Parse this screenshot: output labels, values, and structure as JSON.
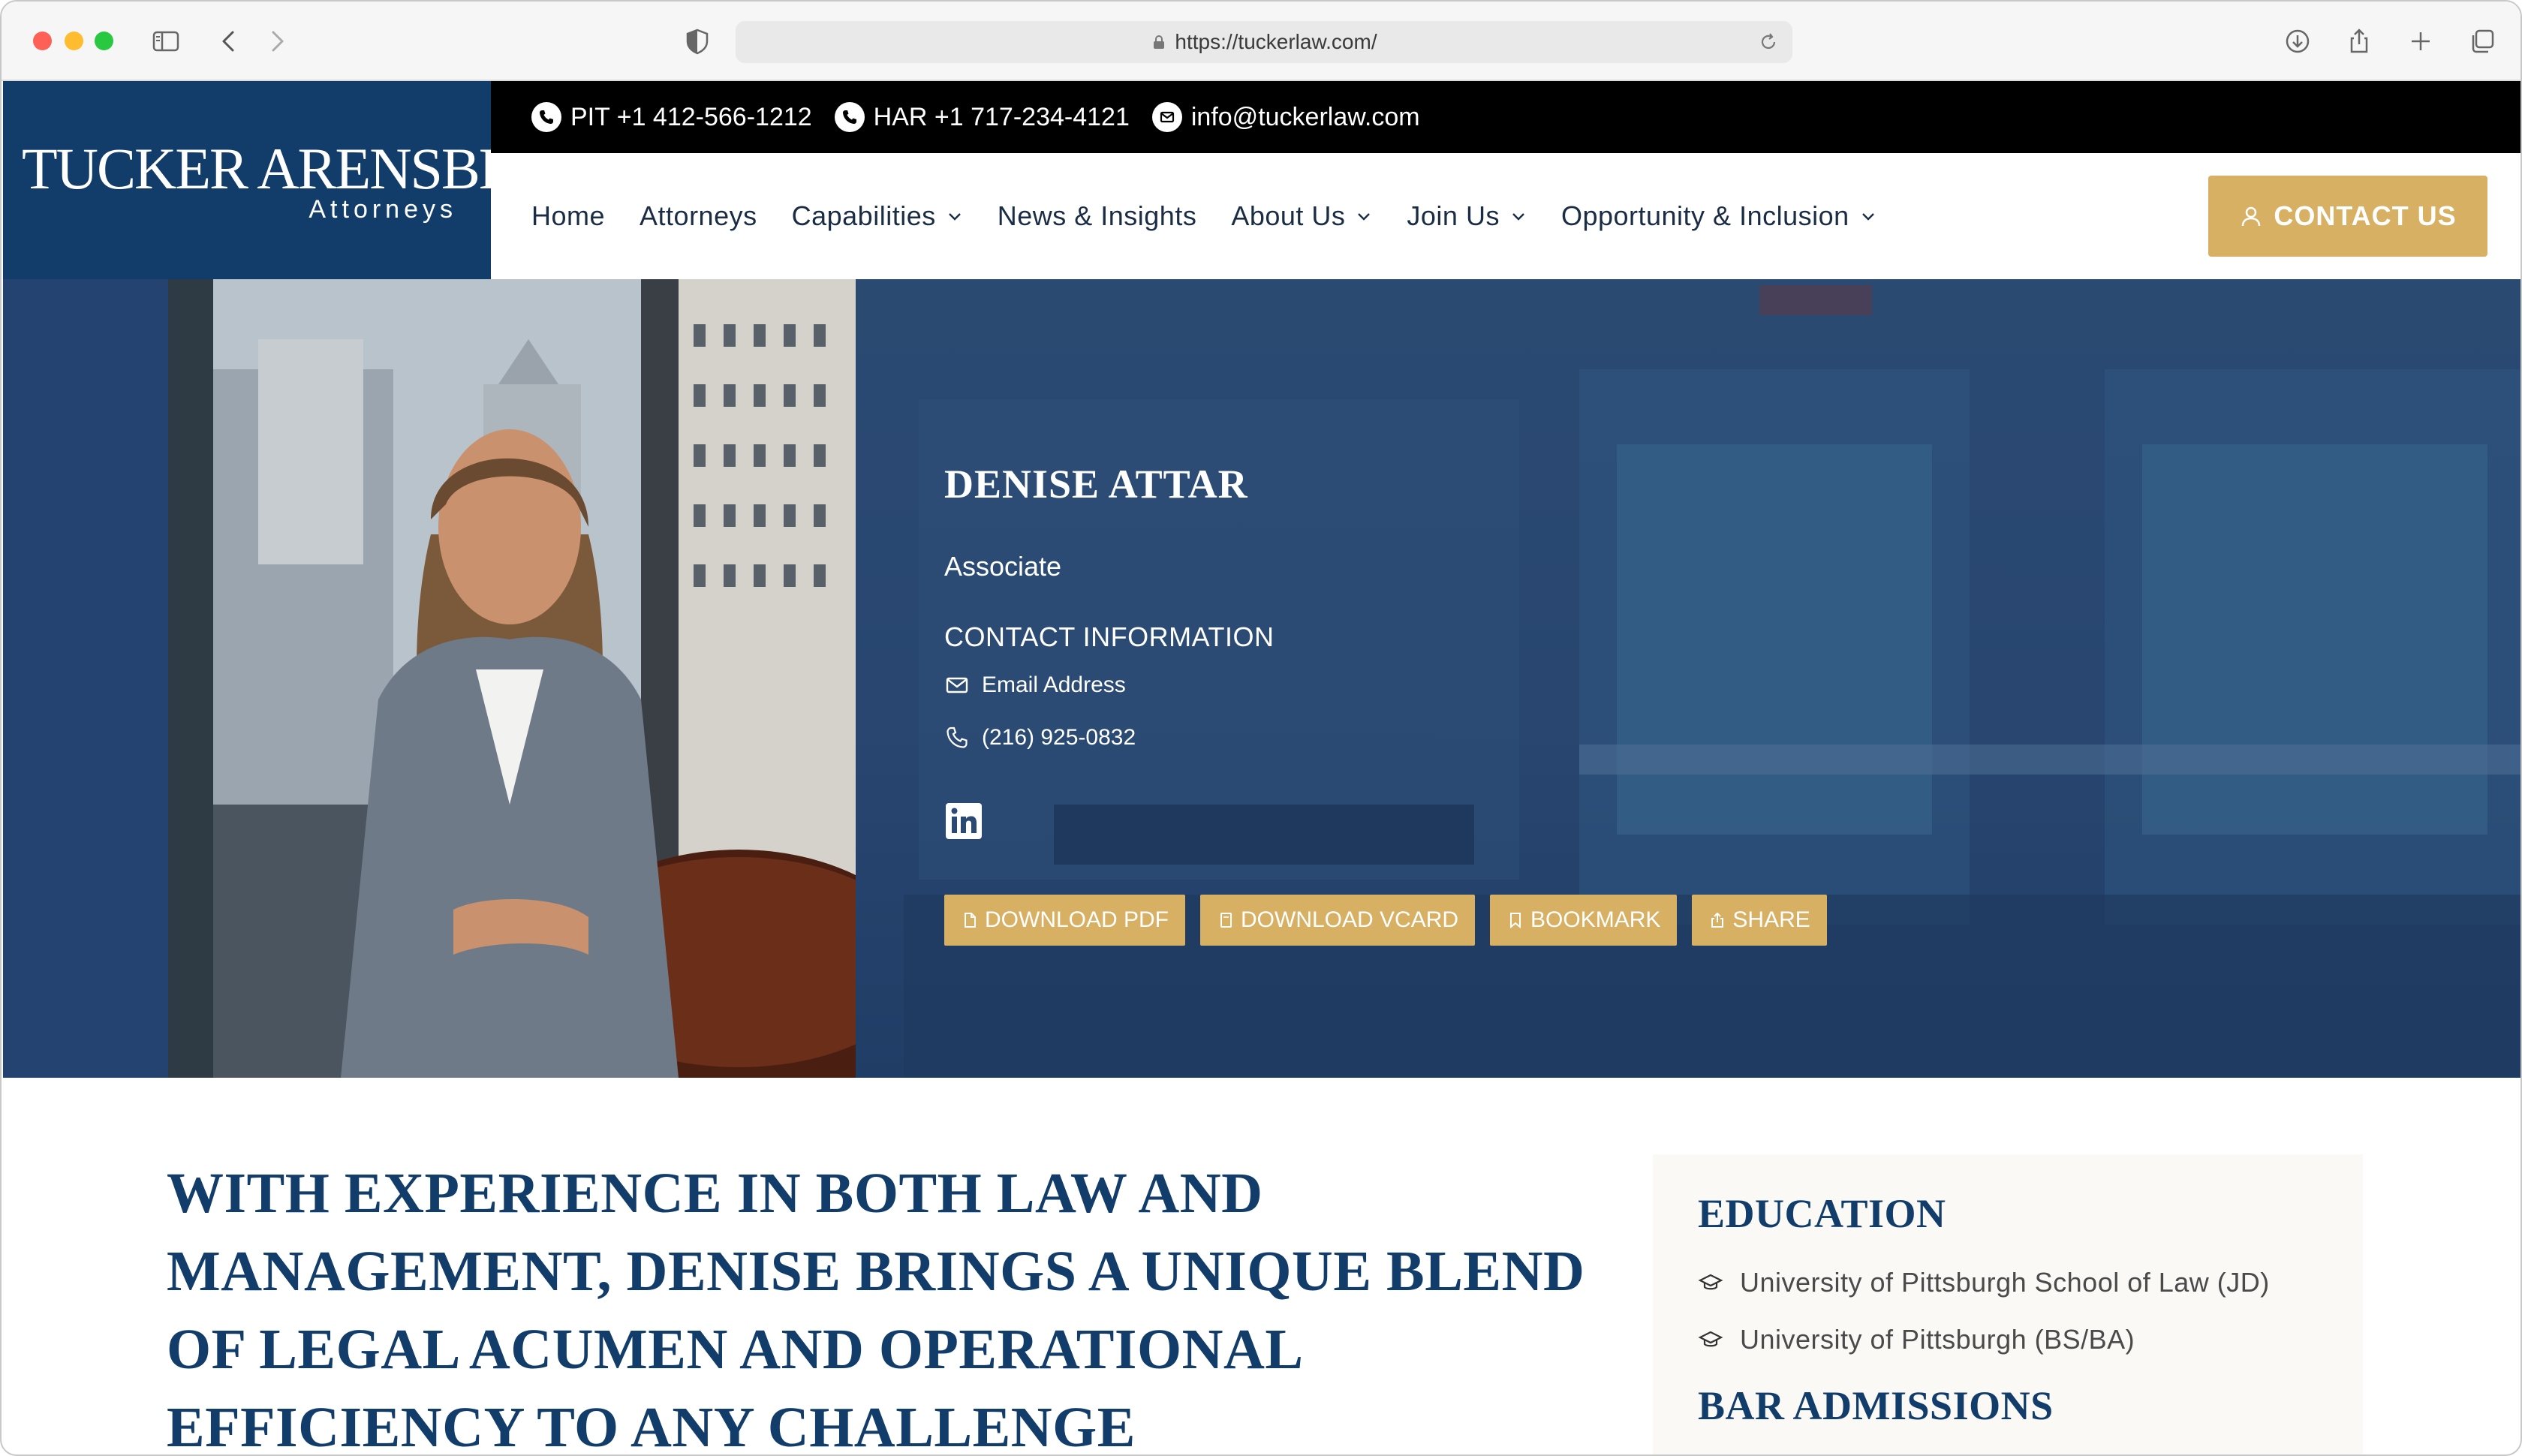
{
  "browser": {
    "url": "https://tuckerlaw.com/"
  },
  "topbar": {
    "pit": "PIT +1 412-566-1212",
    "har": "HAR +1 717-234-4121",
    "email": "info@tuckerlaw.com"
  },
  "logo": {
    "name": "TUCKER ARENSBERG",
    "sub": "Attorneys"
  },
  "nav": {
    "items": [
      {
        "label": "Home",
        "dropdown": false
      },
      {
        "label": "Attorneys",
        "dropdown": false
      },
      {
        "label": "Capabilities",
        "dropdown": true
      },
      {
        "label": "News & Insights",
        "dropdown": false
      },
      {
        "label": "About Us",
        "dropdown": true
      },
      {
        "label": "Join Us",
        "dropdown": true
      },
      {
        "label": "Opportunity & Inclusion",
        "dropdown": true
      }
    ],
    "contact_label": "CONTACT US"
  },
  "profile": {
    "name": "DENISE ATTAR",
    "title": "Associate",
    "contact_heading": "CONTACT INFORMATION",
    "email_label": "Email Address",
    "phone": "(216) 925-0832",
    "buttons": {
      "pdf": "DOWNLOAD PDF",
      "vcard": "DOWNLOAD VCARD",
      "bookmark": "BOOKMARK",
      "share": "SHARE"
    }
  },
  "quote": "WITH EXPERIENCE IN BOTH LAW AND MANAGEMENT, DENISE BRINGS A UNIQUE BLEND OF LEGAL ACUMEN AND OPERATIONAL EFFICIENCY TO ANY CHALLENGE",
  "sidebar": {
    "education_heading": "EDUCATION",
    "education": [
      "University of Pittsburgh School of Law (JD)",
      "University of Pittsburgh (BS/BA)"
    ],
    "bar_heading": "BAR ADMISSIONS"
  },
  "colors": {
    "navy": "#123d6b",
    "gold": "#d8b064",
    "black": "#000000"
  },
  "icons": [
    "sidebar-icon",
    "back-icon",
    "forward-icon",
    "shield-icon",
    "lock-icon",
    "reload-icon",
    "download-icon",
    "share-icon",
    "plus-icon",
    "tabs-icon",
    "phone-icon",
    "mail-icon",
    "user-icon",
    "chevron-down-icon",
    "linkedin-icon",
    "file-icon",
    "bookmark-icon",
    "graduation-cap-icon"
  ]
}
